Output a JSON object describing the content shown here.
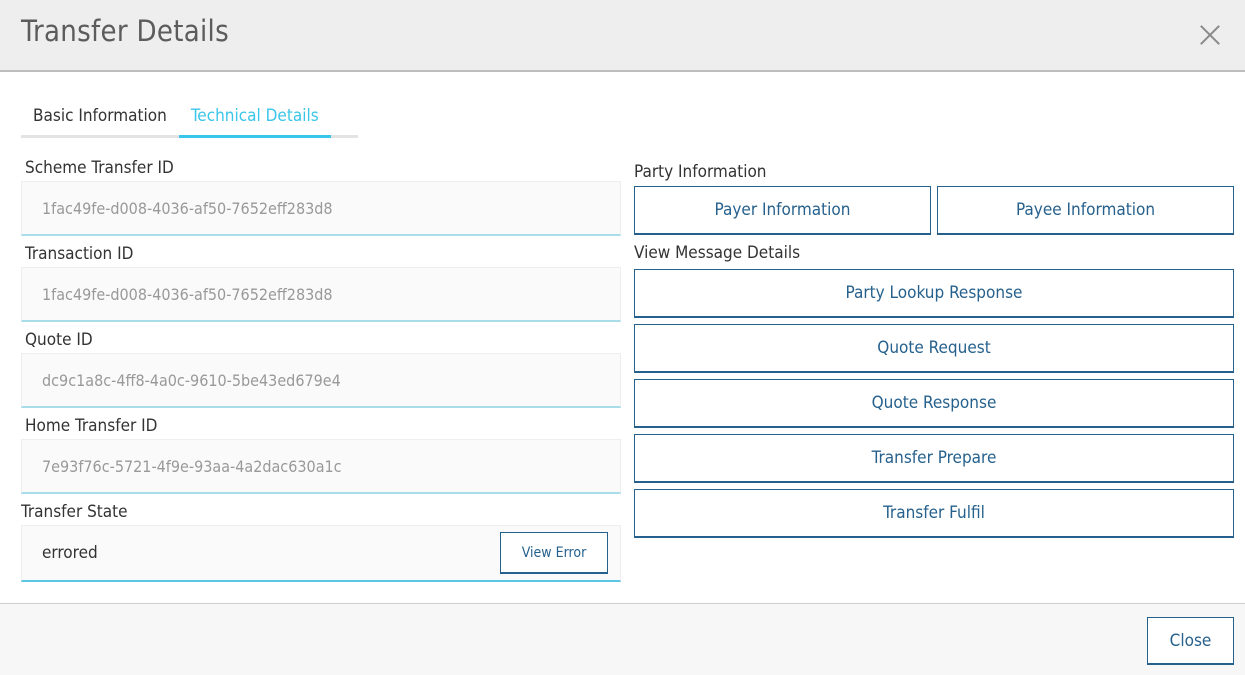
{
  "modal": {
    "title": "Transfer Details",
    "close_icon": "close-icon"
  },
  "tabs": [
    {
      "label": "Basic Information",
      "active": false
    },
    {
      "label": "Technical Details",
      "active": true
    }
  ],
  "fields": [
    {
      "label": "Scheme Transfer ID",
      "value": "1fac49fe-d008-4036-af50-7652eff283d8"
    },
    {
      "label": "Transaction ID",
      "value": "1fac49fe-d008-4036-af50-7652eff283d8"
    },
    {
      "label": "Quote ID",
      "value": "dc9c1a8c-4ff8-4a0c-9610-5be43ed679e4"
    },
    {
      "label": "Home Transfer ID",
      "value": "7e93f76c-5721-4f9e-93aa-4a2dac630a1c"
    }
  ],
  "transfer_state": {
    "label": "Transfer State",
    "value": "errored",
    "view_error_label": "View Error"
  },
  "party_information": {
    "label": "Party Information",
    "payer_label": "Payer Information",
    "payee_label": "Payee Information"
  },
  "message_details": {
    "label": "View Message Details",
    "buttons": [
      "Party Lookup Response",
      "Quote Request",
      "Quote Response",
      "Transfer Prepare",
      "Transfer Fulfil"
    ]
  },
  "footer": {
    "close_label": "Close"
  },
  "colors": {
    "accent": "#3ac6e8",
    "primary": "#26618d"
  }
}
